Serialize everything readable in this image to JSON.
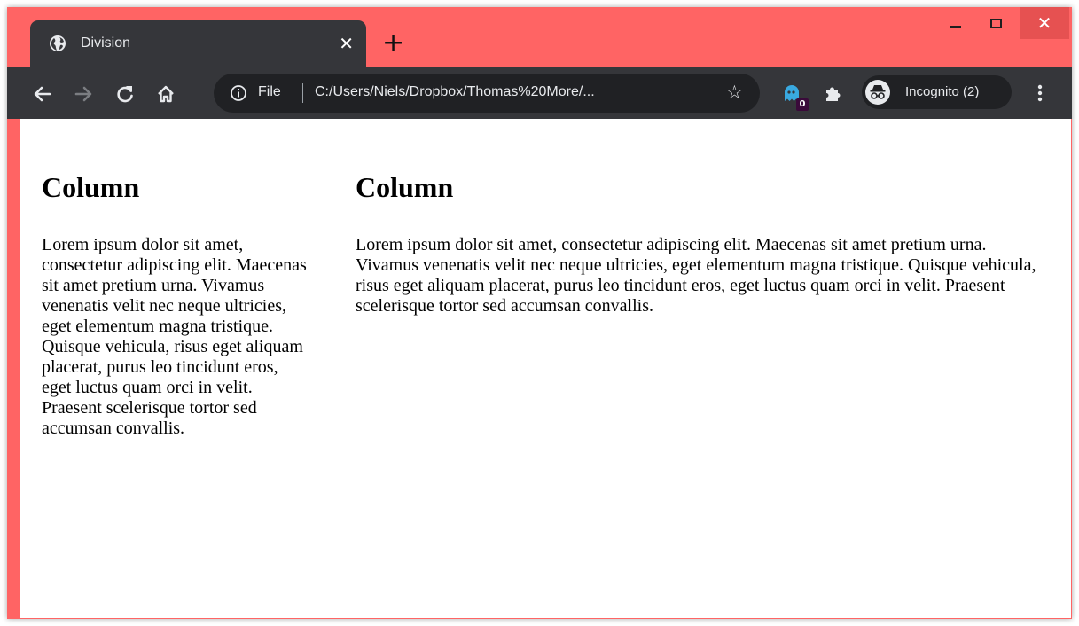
{
  "browser": {
    "tab": {
      "title": "Division",
      "close": "✕"
    },
    "new_tab": "+",
    "window_controls": {
      "close": "✕"
    },
    "omnibox": {
      "security_label": "File",
      "url": "C:/Users/Niels/Dropbox/Thomas%20More/...",
      "star": "☆"
    },
    "extensions": {
      "badge_count": "0"
    },
    "profile": {
      "label": "Incognito (2)"
    },
    "colors": {
      "frame": "#ff6464",
      "toolbar": "#35363a",
      "omnibox": "#202124",
      "close_button": "#e65151"
    }
  },
  "page": {
    "left_column": {
      "heading": "Column",
      "text": "Lorem ipsum dolor sit amet, consectetur adipiscing elit. Maecenas sit amet pretium urna. Vivamus venenatis velit nec neque ultricies, eget elementum magna tristique. Quisque vehicula, risus eget aliquam placerat, purus leo tincidunt eros, eget luctus quam orci in velit. Praesent scelerisque tortor sed accumsan convallis."
    },
    "right_column": {
      "heading": "Column",
      "text": "Lorem ipsum dolor sit amet, consectetur adipiscing elit. Maecenas sit amet pretium urna. Vivamus venenatis velit nec neque ultricies, eget elementum magna tristique. Quisque vehicula, risus eget aliquam placerat, purus leo tincidunt eros, eget luctus quam orci in velit. Praesent scelerisque tortor sed accumsan convallis."
    }
  }
}
